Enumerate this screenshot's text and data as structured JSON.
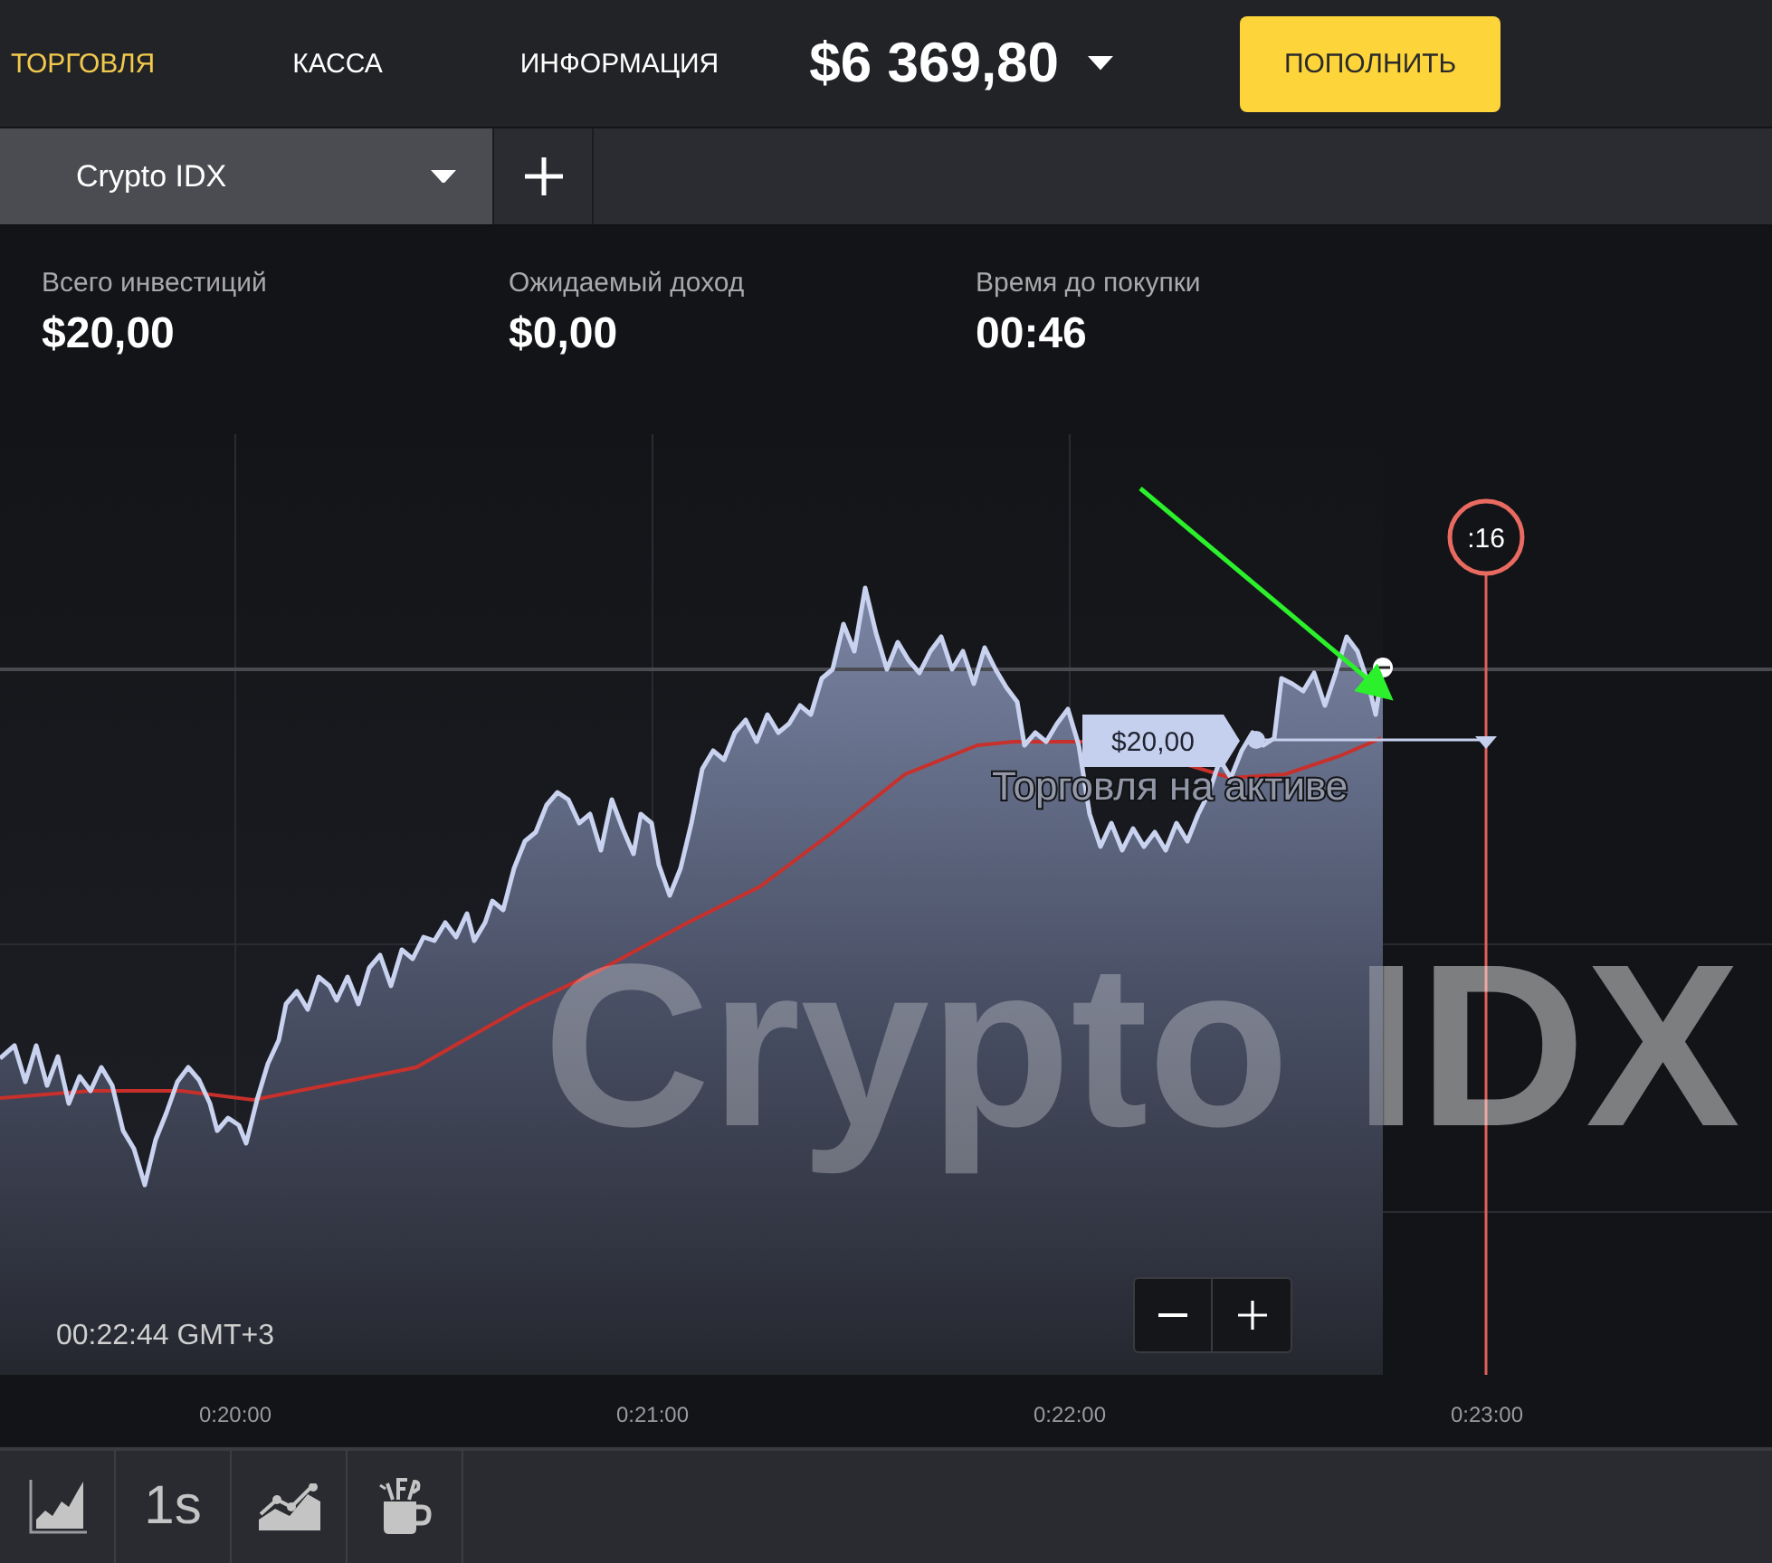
{
  "nav": {
    "tabs": [
      {
        "label": "ТОРГОВЛЯ",
        "selected": true
      },
      {
        "label": "КАССА",
        "selected": false
      },
      {
        "label": "ИНФОРМАЦИЯ",
        "selected": false
      }
    ],
    "balance": "$6 369,80",
    "deposit_button": "ПОПОЛНИТЬ"
  },
  "asset_tabs": [
    {
      "label": "Crypto IDX",
      "selected": true
    }
  ],
  "stats": [
    {
      "label": "Всего инвестиций",
      "value": "$20,00"
    },
    {
      "label": "Ожидаемый доход",
      "value": "$0,00"
    },
    {
      "label": "Время до покупки",
      "value": "00:46"
    }
  ],
  "chart": {
    "asset_name": "Crypto IDX",
    "caption": "Торговля на активе",
    "deal_amount": "$20,00",
    "timer": ":16",
    "time_axis": [
      "0:20:00",
      "0:21:00",
      "0:22:00",
      "0:23:00"
    ],
    "clock": "00:22:44 GMT+3"
  },
  "toolbar": [
    {
      "kind": "chart-type"
    },
    {
      "kind": "timeframe",
      "label": "1s"
    },
    {
      "kind": "indicators"
    },
    {
      "kind": "drawings"
    }
  ]
}
